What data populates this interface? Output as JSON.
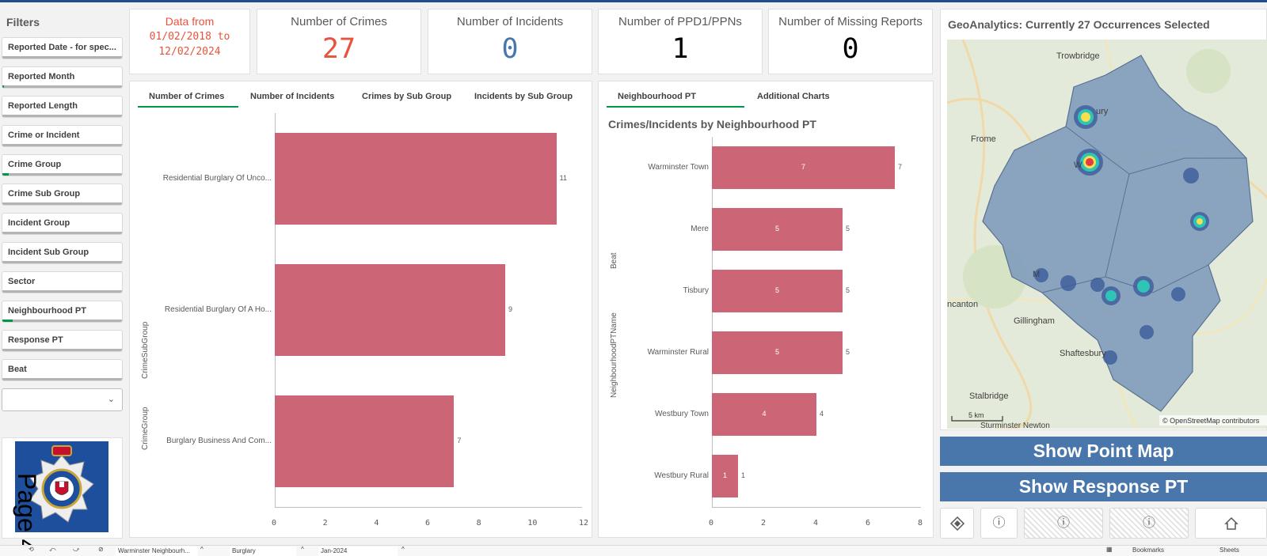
{
  "sidebar": {
    "title": "Filters",
    "filters": [
      {
        "label": "Reported Date - for spec...",
        "sel": 0
      },
      {
        "label": "Reported Month",
        "sel": 2
      },
      {
        "label": "Reported Length",
        "sel": 0
      },
      {
        "label": "Crime or Incident",
        "sel": 0
      },
      {
        "label": "Crime Group",
        "sel": 8
      },
      {
        "label": "Crime Sub Group",
        "sel": 0
      },
      {
        "label": "Incident Group",
        "sel": 0
      },
      {
        "label": "Incident Sub Group",
        "sel": 0
      },
      {
        "label": "Sector",
        "sel": 0
      },
      {
        "label": "Neighbourhood PT",
        "sel": 13
      },
      {
        "label": "Response PT",
        "sel": 0
      },
      {
        "label": "Beat",
        "sel": 0
      }
    ],
    "page_text": "Page 4"
  },
  "kpis": {
    "date_line1": "Data from",
    "date_line2": "01/02/2018 to",
    "date_line3": "12/02/2024",
    "crimes_label": "Number of Crimes",
    "crimes_value": "27",
    "incidents_label": "Number of Incidents",
    "incidents_value": "0",
    "ppd_label": "Number of PPD1/PPNs",
    "ppd_value": "1",
    "missing_label": "Number of Missing Reports",
    "missing_value": "0"
  },
  "left_panel": {
    "tabs": [
      "Number of Crimes",
      "Number of Incidents",
      "Crimes by Sub Group",
      "Incidents by Sub Group"
    ],
    "axis_title_1": "CrimeSubGroup",
    "axis_title_2": "CrimeGroup"
  },
  "right_panel": {
    "tabs": [
      "Neighbourhood PT",
      "Additional Charts"
    ],
    "title": "Crimes/Incidents by Neighbourhood PT",
    "axis_title_1": "Beat",
    "axis_title_2": "NeighbourhoodPTName"
  },
  "chart_data": [
    {
      "type": "bar",
      "orientation": "horizontal",
      "categories": [
        "Residential Burglary Of Unco...",
        "Residential Burglary Of A Ho...",
        "Burglary Business And Com..."
      ],
      "values": [
        11,
        9,
        7
      ],
      "xlim": [
        0,
        12
      ],
      "xticks": [
        "0",
        "2",
        "4",
        "6",
        "8",
        "10",
        "12"
      ],
      "ylabel": "CrimeSubGroup"
    },
    {
      "type": "bar",
      "orientation": "horizontal",
      "title": "Crimes/Incidents by Neighbourhood PT",
      "categories": [
        "Warminster Town",
        "Mere",
        "Tisbury",
        "Warminster Rural",
        "Westbury Town",
        "Westbury Rural"
      ],
      "values": [
        7,
        5,
        5,
        5,
        4,
        1
      ],
      "xlim": [
        0,
        8
      ],
      "xticks": [
        "0",
        "2",
        "4",
        "6",
        "8"
      ],
      "ylabel": "NeighbourhoodPTName"
    }
  ],
  "map": {
    "title": "GeoAnalytics: Currently 27 Occurrences Selected",
    "places": {
      "trowbridge": "Trowbridge",
      "frome": "Frome",
      "gillingham": "Gillingham",
      "shaftesbury": "Shaftesbury",
      "stalbridge": "Stalbridge",
      "wincanton": "ncanton",
      "sturminster": "Sturminster Newton",
      "westbury": "ury",
      "warminster": "W",
      "mere": "M"
    },
    "scale": "5 km",
    "attribution": "© OpenStreetMap contributors"
  },
  "buttons": {
    "point_map": "Show Point Map",
    "response_pt": "Show Response PT",
    "info": "ⓘ"
  },
  "bottom": {
    "chip1": "Warminster Neighbourh...",
    "chip2": "Burglary",
    "chip3": "Jan-2024",
    "bookmarks": "Bookmarks",
    "sheets": "Sheets"
  },
  "colors": {
    "accent": "#009845",
    "bar": "#cc6677",
    "crimes": "#e8533c",
    "incidents": "#4a77ab",
    "button": "#4a77ab"
  }
}
